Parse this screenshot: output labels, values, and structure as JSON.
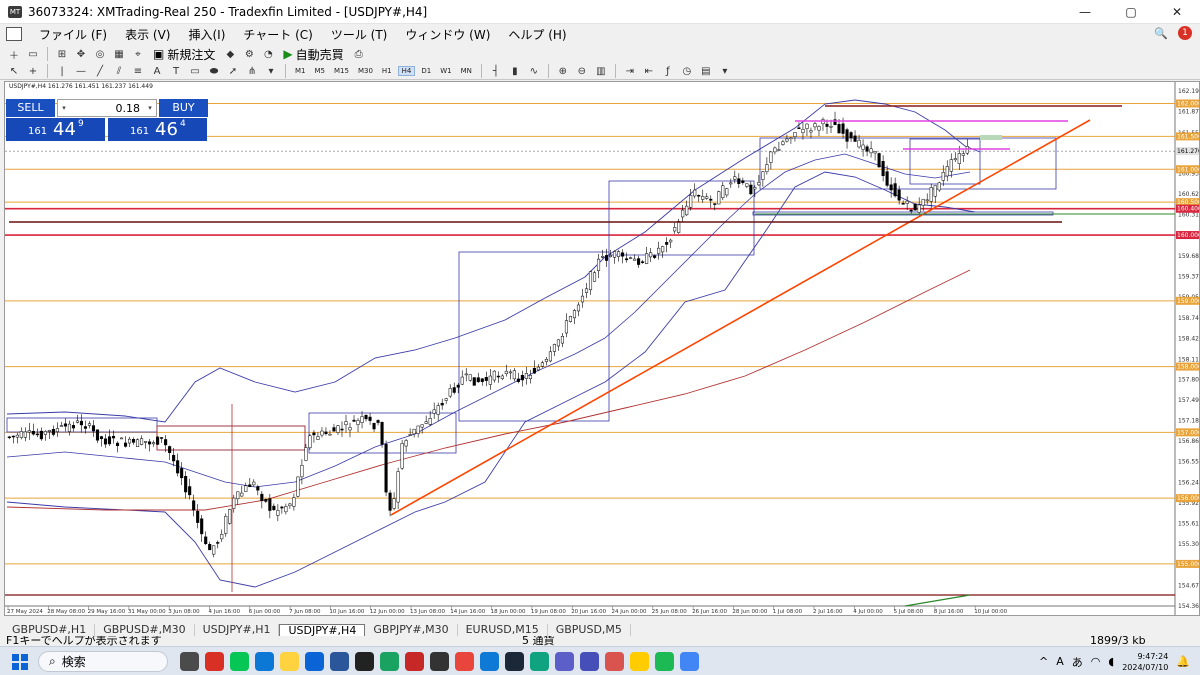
{
  "window": {
    "title": "36073324: XMTrading-Real 250 - Tradexfin Limited - [USDJPY#,H4]",
    "controls": [
      "—",
      "▢",
      "✕"
    ]
  },
  "menu": {
    "items": [
      "ファイル (F)",
      "表示 (V)",
      "挿入(I)",
      "チャート (C)",
      "ツール (T)",
      "ウィンドウ (W)",
      "ヘルプ (H)"
    ],
    "notification_count": "1"
  },
  "toolbar": {
    "new_order_label": "新規注文",
    "auto_trade_label": "自動売買",
    "timeframes": [
      "M1",
      "M5",
      "M15",
      "M30",
      "H1",
      "H4",
      "D1",
      "W1",
      "MN"
    ],
    "active_timeframe": "H4"
  },
  "chart": {
    "symbol_info": "USDJPY#,H4  161.276 161.451 161.237 161.449",
    "trade_panel": {
      "sell_label": "SELL",
      "buy_label": "BUY",
      "lot": "0.18",
      "sell_small": "161",
      "sell_big": "44",
      "sell_pip": "9",
      "buy_small": "161",
      "buy_big": "46",
      "buy_pip": "4"
    },
    "price_axis": [
      "162.190",
      "161.875",
      "161.555",
      "161.276",
      "160.935",
      "160.625",
      "160.310",
      "159.995",
      "159.685",
      "159.370",
      "159.055",
      "158.740",
      "158.425",
      "158.110",
      "157.805",
      "157.490",
      "157.180",
      "156.865",
      "156.555",
      "156.240",
      "155.925",
      "155.615",
      "155.300",
      "154.985",
      "154.675",
      "154.360"
    ],
    "level_tags": [
      {
        "price": "162.000",
        "color": "#e8a43a"
      },
      {
        "price": "161.500",
        "color": "#e8a43a"
      },
      {
        "price": "161.000",
        "color": "#e8a43a"
      },
      {
        "price": "160.500",
        "color": "#e8a43a"
      },
      {
        "price": "160.400",
        "color": "#d9263e"
      },
      {
        "price": "160.000",
        "color": "#d9263e"
      },
      {
        "price": "159.000",
        "color": "#e8a43a"
      },
      {
        "price": "158.000",
        "color": "#e8a43a"
      },
      {
        "price": "157.000",
        "color": "#e8a43a"
      },
      {
        "price": "156.000",
        "color": "#e8a43a"
      },
      {
        "price": "155.000",
        "color": "#e8a43a"
      }
    ],
    "current_price": "161.276",
    "time_axis": [
      "27 May 2024",
      "28 May 08:00",
      "29 May 16:00",
      "31 May 00:00",
      "3 Jun 08:00",
      "4 Jun 16:00",
      "6 Jun 00:00",
      "7 Jun 08:00",
      "10 Jun 16:00",
      "12 Jun 00:00",
      "13 Jun 08:00",
      "14 Jun 16:00",
      "18 Jun 00:00",
      "19 Jun 08:00",
      "20 Jun 16:00",
      "24 Jun 00:00",
      "25 Jun 08:00",
      "26 Jun 16:00",
      "28 Jun 00:00",
      "1 Jul 08:00",
      "2 Jul 16:00",
      "4 Jul 00:00",
      "5 Jul 08:00",
      "8 Jul 16:00",
      "10 Jul 00:00"
    ]
  },
  "tabs": [
    "GBPUSD#,H1",
    "GBPUSD#,M30",
    "USDJPY#,H1",
    "USDJPY#,H4",
    "GBPJPY#,M30",
    "EURUSD,M15",
    "GBPUSD,M5"
  ],
  "active_tab": "USDJPY#,H4",
  "status": {
    "help": "F1キーでヘルプが表示されます",
    "connection": "5 通貨",
    "traffic": "1899/3 kb"
  },
  "taskbar": {
    "search_placeholder": "検索",
    "app_icons": [
      "store",
      "red-badge",
      "line",
      "skype",
      "notes",
      "mail",
      "word",
      "xm",
      "sheets",
      "fx",
      "vpn",
      "chrome",
      "edge",
      "steam",
      "chatgpt",
      "copilot",
      "teams",
      "news",
      "notes2",
      "spotify",
      "chrome2"
    ],
    "tray_ime1": "A",
    "tray_ime2": "あ",
    "time": "9:47:24",
    "date": "2024/07/10"
  }
}
